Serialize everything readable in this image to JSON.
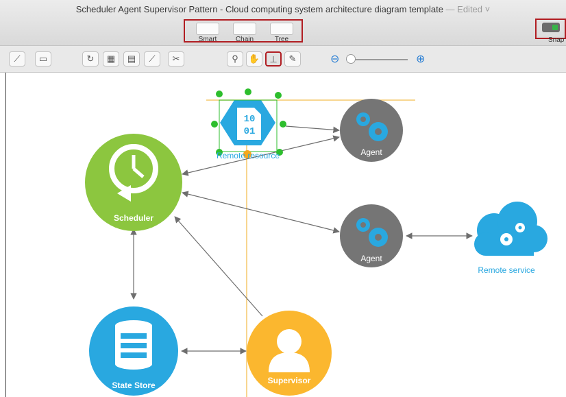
{
  "window": {
    "title": "Scheduler Agent Supervisor Pattern - Cloud computing system architecture diagram template",
    "status": "— Edited ˅"
  },
  "toolbar": {
    "layout_buttons": [
      "Smart",
      "Chain",
      "Tree"
    ],
    "snap_label": "Snap",
    "zoom_level": 0.08
  },
  "nodes": {
    "remote_resource": {
      "label": "Remote resource",
      "glyph": "10\n01"
    },
    "agent_top": {
      "label": "Agent"
    },
    "agent_mid": {
      "label": "Agent"
    },
    "scheduler": {
      "label": "Scheduler"
    },
    "remote_service": {
      "label": "Remote service"
    },
    "state_store": {
      "label": "State Store"
    },
    "supervisor": {
      "label": "Supervisor"
    }
  },
  "colors": {
    "scheduler": "#8cc63f",
    "agent": "#757575",
    "gear": "#29a8e0",
    "state_store": "#29a8e0",
    "supervisor": "#fbb72f",
    "remote_resource": "#29a8e0",
    "selection": "#2dbe2d",
    "guide": "#f6c96b",
    "accent_red": "#b11d22"
  }
}
